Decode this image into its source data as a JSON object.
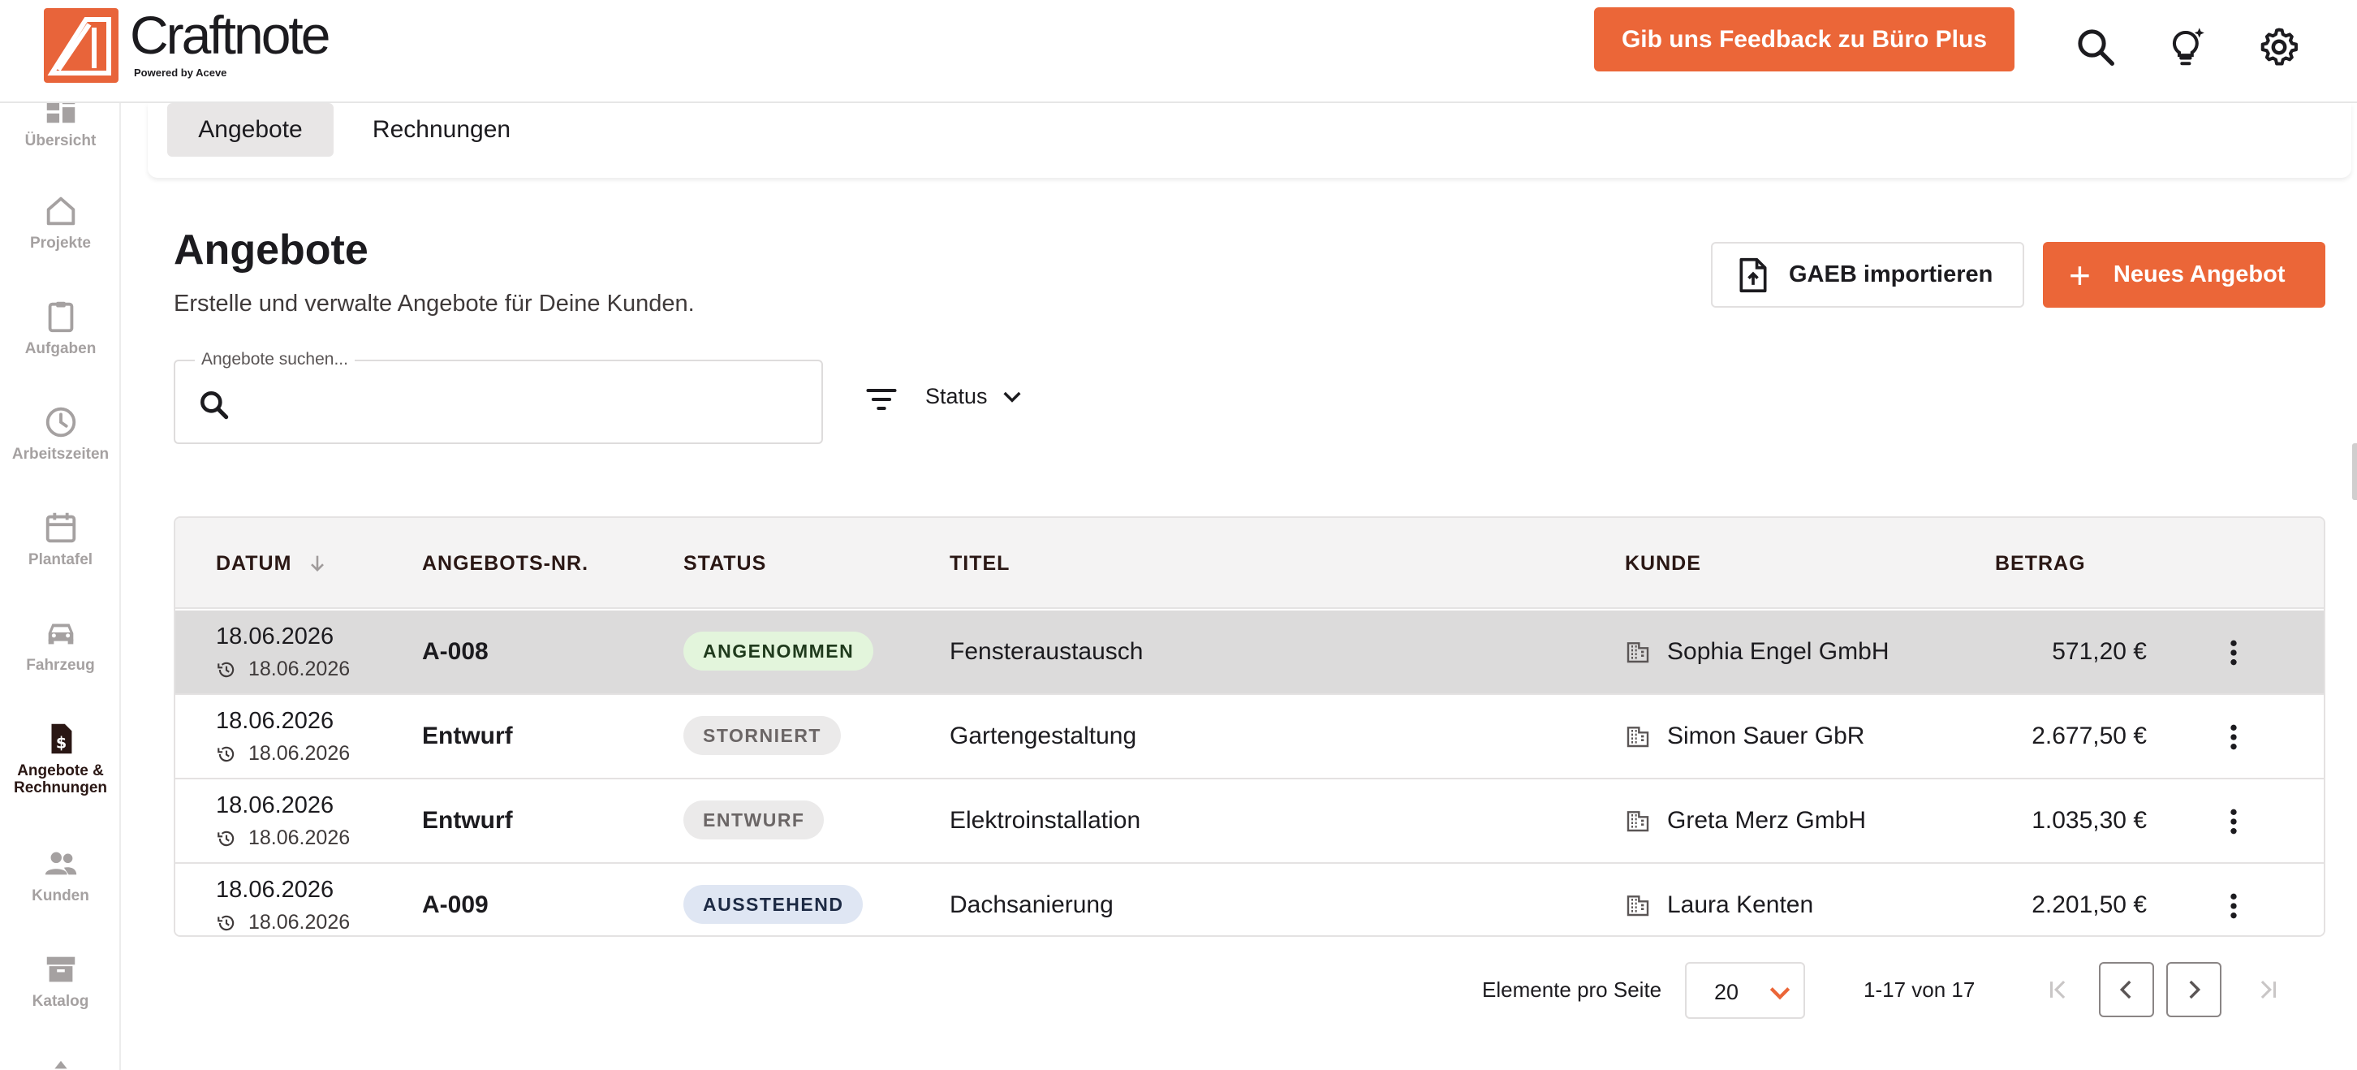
{
  "brand": {
    "name": "Craftnote",
    "powered_by": "Powered by Aceve",
    "accent_color": "#eb6638"
  },
  "header": {
    "feedback_label": "Gib uns Feedback zu Büro Plus",
    "icons": [
      "search-icon",
      "lightbulb-icon",
      "gear-icon"
    ]
  },
  "sidebar": {
    "items": [
      {
        "label": "Übersicht",
        "icon": "dashboard-icon",
        "active": false
      },
      {
        "label": "Projekte",
        "icon": "house-icon",
        "active": false
      },
      {
        "label": "Aufgaben",
        "icon": "clipboard-icon",
        "active": false
      },
      {
        "label": "Arbeitszeiten",
        "icon": "clock-icon",
        "active": false
      },
      {
        "label": "Plantafel",
        "icon": "calendar-icon",
        "active": false
      },
      {
        "label": "Fahrzeug",
        "icon": "car-icon",
        "active": false
      },
      {
        "label": "Angebote & Rechnungen",
        "icon": "invoice-icon",
        "active": true
      },
      {
        "label": "Kunden",
        "icon": "people-icon",
        "active": false
      },
      {
        "label": "Katalog",
        "icon": "archive-icon",
        "active": false
      }
    ]
  },
  "tabs": [
    {
      "label": "Angebote",
      "active": true
    },
    {
      "label": "Rechnungen",
      "active": false
    }
  ],
  "page": {
    "title": "Angebote",
    "subtitle": "Erstelle und verwalte Angebote für Deine Kunden.",
    "gaeb_label": "GAEB importieren",
    "new_label": "Neues Angebot",
    "new_plus": "+"
  },
  "search": {
    "label": "Angebote suchen...",
    "value": ""
  },
  "filter": {
    "status_label": "Status"
  },
  "table": {
    "columns": [
      "DATUM",
      "ANGEBOTS-NR.",
      "STATUS",
      "TITEL",
      "KUNDE",
      "BETRAG"
    ],
    "sort": {
      "column": "DATUM",
      "direction": "desc"
    },
    "rows": [
      {
        "date": "18.06.2026",
        "modified": "18.06.2026",
        "number": "A-008",
        "status": "ANGENOMMEN",
        "status_bg": "#e3f5dc",
        "status_fg": "#1f3a1c",
        "title": "Fensteraustausch",
        "customer": "Sophia Engel GmbH",
        "amount": "571,20 €",
        "selected": true
      },
      {
        "date": "18.06.2026",
        "modified": "18.06.2026",
        "number": "Entwurf",
        "status": "STORNIERT",
        "status_bg": "#ebeaea",
        "status_fg": "#6b6666",
        "title": "Gartengestaltung",
        "customer": "Simon Sauer GbR",
        "amount": "2.677,50 €",
        "selected": false
      },
      {
        "date": "18.06.2026",
        "modified": "18.06.2026",
        "number": "Entwurf",
        "status": "ENTWURF",
        "status_bg": "#ebeaea",
        "status_fg": "#6b6666",
        "title": "Elektroinstallation",
        "customer": "Greta Merz GmbH",
        "amount": "1.035,30 €",
        "selected": false
      },
      {
        "date": "18.06.2026",
        "modified": "18.06.2026",
        "number": "A-009",
        "status": "AUSSTEHEND",
        "status_bg": "#dfe6f3",
        "status_fg": "#1d2a44",
        "title": "Dachsanierung",
        "customer": "Laura Kenten",
        "amount": "2.201,50 €",
        "selected": false
      }
    ]
  },
  "pagination": {
    "per_page_label": "Elemente pro Seite",
    "per_page_value": "20",
    "range_label": "1-17 von 17"
  }
}
